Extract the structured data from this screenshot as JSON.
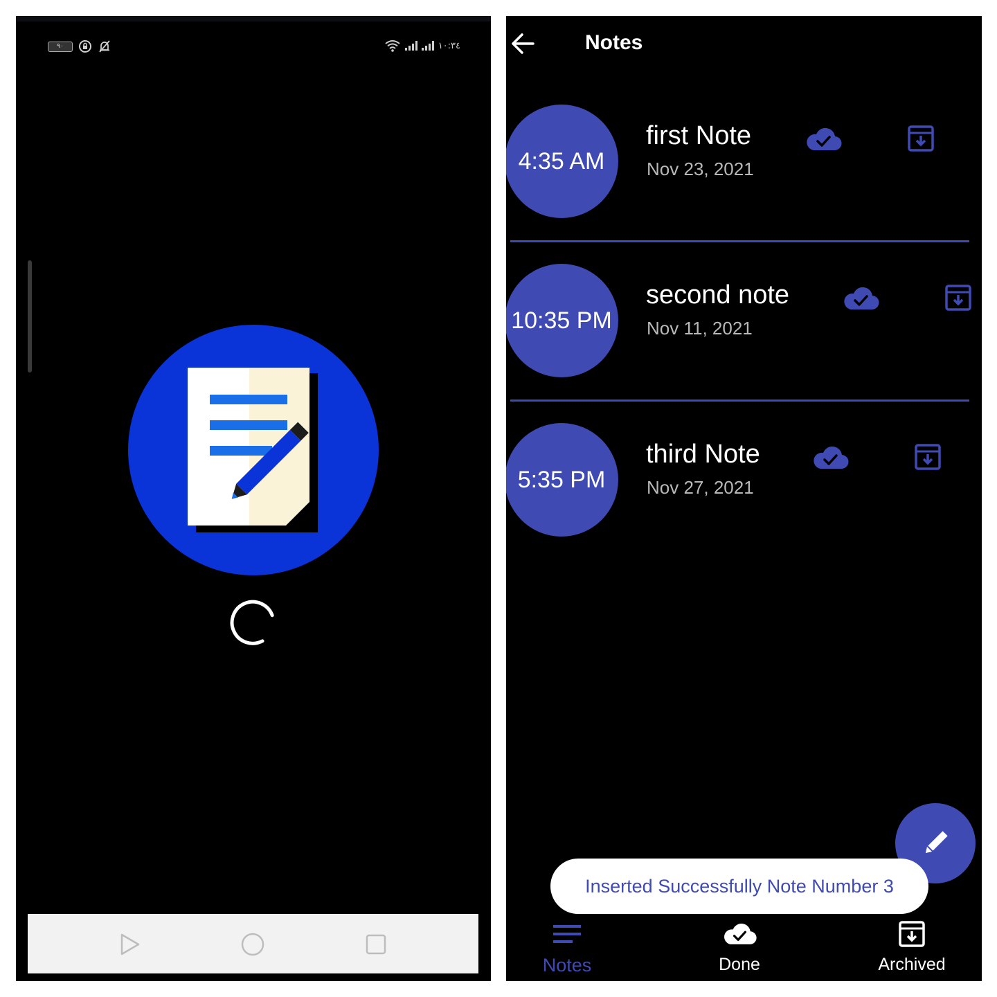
{
  "splash": {
    "status_bar": {
      "battery": "٩٠",
      "time": "١٠:٣٤"
    },
    "colors": {
      "logo_circle": "#0a33d8",
      "background": "#000000",
      "navbar": "#f2f2f2"
    },
    "icons": [
      "battery-icon",
      "lock-rotation-icon",
      "muted-bell-icon",
      "wifi-icon",
      "signal-icon",
      "notepad-pencil-logo-icon",
      "loading-spinner-icon",
      "back-triangle-icon",
      "home-circle-icon",
      "recents-square-icon"
    ]
  },
  "notes_screen": {
    "header": {
      "title": "Notes"
    },
    "colors": {
      "accent": "#3f4ab3",
      "background": "#000000",
      "date_text": "#b8b8b8"
    },
    "notes": [
      {
        "time": "4:35 AM",
        "title": "first Note",
        "date": "Nov 23, 2021"
      },
      {
        "time": "10:35 PM",
        "title": "second note",
        "date": "Nov 11, 2021"
      },
      {
        "time": "5:35 PM",
        "title": "third Note",
        "date": "Nov 27, 2021"
      }
    ],
    "toast": "Inserted Successfully Note Number 3",
    "bottom_nav": {
      "notes": "Notes",
      "done": "Done",
      "archived": "Archived",
      "selected": "Notes"
    }
  }
}
